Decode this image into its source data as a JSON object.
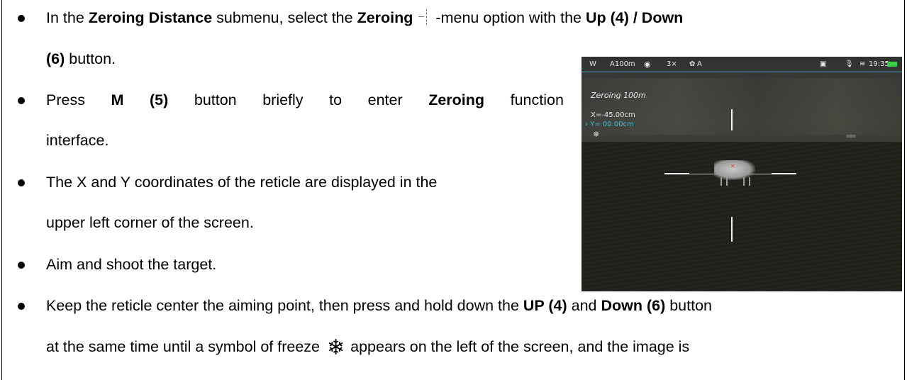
{
  "instructions": {
    "line1": {
      "p1": "In the ",
      "b1": "Zeroing Distance",
      "p2": " submenu, select the ",
      "b2": "Zeroing",
      "p3": "-menu option with the ",
      "b3": "Up (4) / Down"
    },
    "line2": {
      "b1": "(6)",
      "p1": " button."
    },
    "line3": {
      "w1": "Press",
      "b1": "M",
      "b2": "(5)",
      "w2": "button",
      "w3": "briefly",
      "w4": "to",
      "w5": "enter",
      "b3": "Zeroing",
      "w6": "function"
    },
    "line4": {
      "p1": "interface."
    },
    "line5": {
      "p1": "The X and Y coordinates of the reticle are displayed in the"
    },
    "line6": {
      "p1": "upper left corner of the screen."
    },
    "line7": {
      "p1": "Aim and shoot the target."
    },
    "line8": {
      "p1": "Keep the reticle center the aiming point, then press and hold down the ",
      "b1": "UP (4)",
      "p2": " and ",
      "b2": "Down (6)",
      "p3": " button"
    },
    "line9": {
      "p1": "at the same time until a symbol of freeze",
      "p2": "appears on the left of the screen, and the image is"
    },
    "icons": [
      "zeroing-cross-icon",
      "freeze-snowflake-icon"
    ]
  },
  "device_screen": {
    "status_bar": {
      "mode": "W",
      "distance": "A100m",
      "zoom": "3×",
      "calibration": "A",
      "time": "19:35"
    },
    "zeroing_label": "Zeroing 100m",
    "x_coord": "X=-45.00cm",
    "y_coord": "Y= 00.00cm",
    "accent_color": "#2ec4dc",
    "battery_color": "#39d04a"
  }
}
